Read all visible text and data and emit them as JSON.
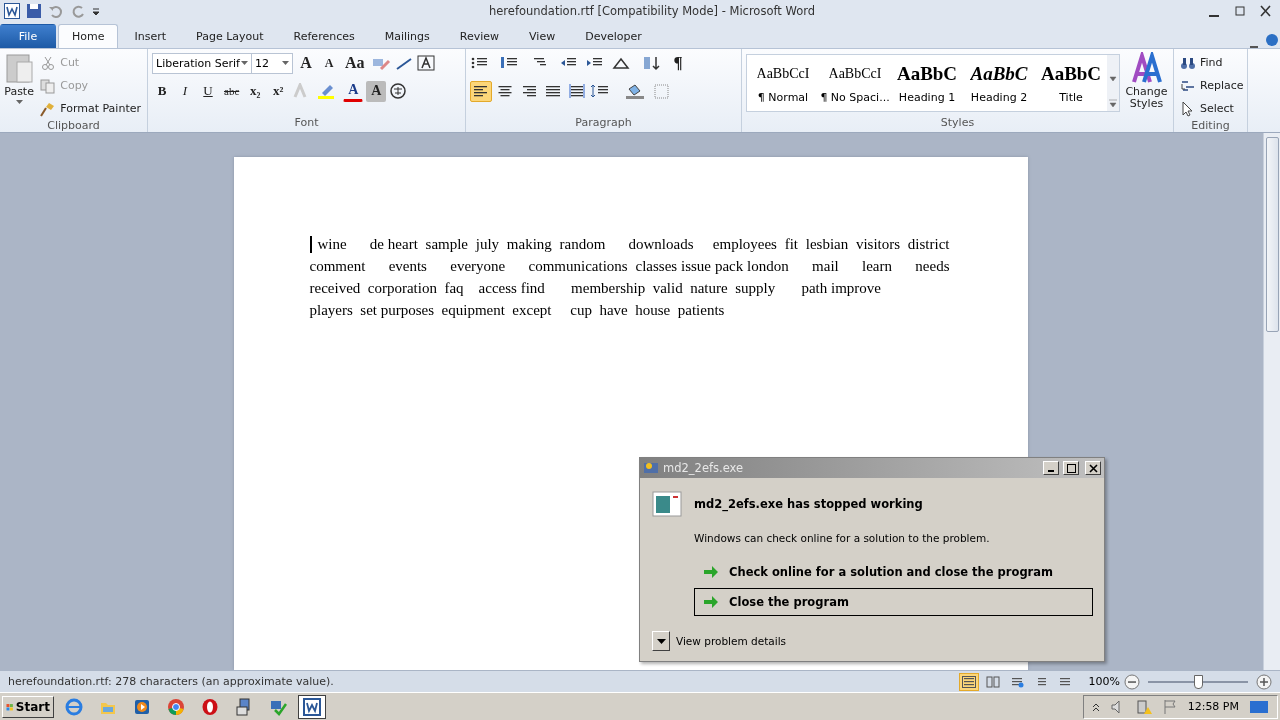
{
  "window": {
    "title": "herefoundation.rtf [Compatibility Mode] - Microsoft Word"
  },
  "tabs": [
    {
      "label": "File",
      "kind": "file",
      "selected": false
    },
    {
      "label": "Home",
      "kind": "tab",
      "selected": true
    },
    {
      "label": "Insert",
      "kind": "tab",
      "selected": false
    },
    {
      "label": "Page Layout",
      "kind": "tab",
      "selected": false
    },
    {
      "label": "References",
      "kind": "tab",
      "selected": false
    },
    {
      "label": "Mailings",
      "kind": "tab",
      "selected": false
    },
    {
      "label": "Review",
      "kind": "tab",
      "selected": false
    },
    {
      "label": "View",
      "kind": "tab",
      "selected": false
    },
    {
      "label": "Developer",
      "kind": "tab",
      "selected": false
    }
  ],
  "clipboard": {
    "label": "Clipboard",
    "paste": "Paste",
    "items": [
      {
        "label": "Cut",
        "kind": "cut",
        "disabled": true
      },
      {
        "label": "Copy",
        "kind": "copy",
        "disabled": true
      },
      {
        "label": "Format Painter",
        "kind": "painter",
        "disabled": false
      }
    ]
  },
  "font": {
    "label": "Font",
    "font_name": "Liberation Serif",
    "font_size": "12",
    "row1": [
      {
        "label": "A",
        "kind": "grow"
      },
      {
        "label": "A",
        "kind": "shrink"
      },
      {
        "label": "Aa",
        "kind": "case"
      }
    ],
    "row2": [
      {
        "label": "B",
        "kind": "bold"
      },
      {
        "label": "I",
        "kind": "italic"
      },
      {
        "label": "U",
        "kind": "underline"
      },
      {
        "label": "abc",
        "kind": "strike"
      },
      {
        "label": "x₂",
        "kind": "sub"
      },
      {
        "label": "x²",
        "kind": "sup"
      }
    ],
    "color_letter": "A",
    "shade_letter": "A"
  },
  "paragraph": {
    "label": "Paragraph",
    "marks": "¶",
    "alignments": [
      {
        "kind": "left",
        "selected": true
      },
      {
        "kind": "center",
        "selected": false
      },
      {
        "kind": "right",
        "selected": false
      },
      {
        "kind": "justify",
        "selected": false
      },
      {
        "kind": "distributed",
        "selected": false
      }
    ]
  },
  "styles": {
    "label": "Styles",
    "items": [
      {
        "preview": "AaBbCcI",
        "name": "¶ Normal",
        "kind": "normal"
      },
      {
        "preview": "AaBbCcI",
        "name": "¶ No Spaci...",
        "kind": "normal"
      },
      {
        "preview": "AaBbC",
        "name": "Heading 1",
        "kind": "heading1"
      },
      {
        "preview": "AaBbC",
        "name": "Heading 2",
        "kind": "heading2"
      },
      {
        "preview": "AaBbC",
        "name": "Title",
        "kind": "title"
      }
    ],
    "change": "Change Styles"
  },
  "editing": {
    "label": "Editing",
    "items": [
      {
        "label": "Find",
        "kind": "find"
      },
      {
        "label": "Replace",
        "kind": "replace"
      },
      {
        "label": "Select",
        "kind": "select"
      }
    ]
  },
  "document": {
    "lines": [
      {
        "text": "wine      de heart  sample  july  making  random      downloads     employees  fit  lesbian  visitors  district",
        "justified": true
      },
      {
        "text": "comment      events      everyone      communications  classes issue pack london      mail      learn      needs",
        "justified": true
      },
      {
        "text": "received  corporation  faq    access find       membership  valid  nature  supply       path improve",
        "justified": false
      },
      {
        "text": "players  set purposes  equipment  except     cup  have  house  patients",
        "justified": false
      }
    ]
  },
  "dialog": {
    "title": "md2_2efs.exe",
    "heading": "md2_2efs.exe has stopped working",
    "message": "Windows can check online for a solution to the problem.",
    "options": [
      {
        "label": "Check online for a solution and close the program",
        "selected": false
      },
      {
        "label": "Close the program",
        "selected": true
      }
    ],
    "details": "View problem details"
  },
  "status_bar": {
    "text": "herefoundation.rtf: 278 characters (an approximate value).",
    "views": [
      {
        "kind": "print",
        "selected": true
      },
      {
        "kind": "reading",
        "selected": false
      },
      {
        "kind": "web",
        "selected": false
      },
      {
        "kind": "outline",
        "selected": false
      },
      {
        "kind": "draft",
        "selected": false
      }
    ],
    "zoom": "100%",
    "zoom_slider": {
      "level": 0.5
    }
  },
  "taskbar": {
    "start": "Start",
    "apps": [
      {
        "kind": "ie",
        "selected": false
      },
      {
        "kind": "explorer",
        "selected": false
      },
      {
        "kind": "media",
        "selected": false
      },
      {
        "kind": "chrome",
        "selected": false
      },
      {
        "kind": "opera",
        "selected": false
      },
      {
        "kind": "installer",
        "selected": false
      },
      {
        "kind": "setup",
        "selected": false
      },
      {
        "kind": "word",
        "selected": true
      }
    ],
    "clock": "12:58 PM"
  }
}
